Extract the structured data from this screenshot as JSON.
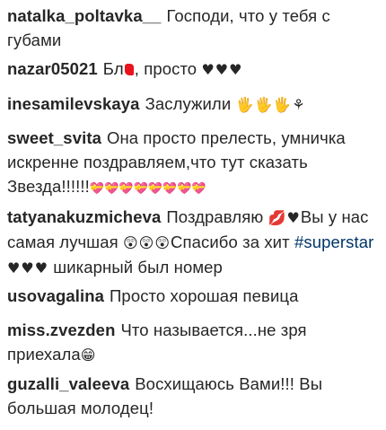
{
  "comments": [
    {
      "user": "natalka_poltavka__",
      "text": "Господи, что у тебя с губами"
    },
    {
      "user": "nazar05021",
      "text_before": "Бл",
      "text_after": ", просто",
      "emoji": "♥♥♥"
    },
    {
      "user": "inesamilevskaya",
      "text": "Заслужили",
      "emoji": "🖐🖐🖐⚘"
    },
    {
      "user": "sweet_svita",
      "text": "Она просто прелесть, умничка искренне поздравляем,что тут сказать Звезда!!!!!!",
      "emoji": "💝💝💝💝💝💝💝💝"
    },
    {
      "user": "tatyanakuzmicheva",
      "text_1": "Поздравляю",
      "emoji_1": "💋♥",
      "text_2": "Вы у нас самая лучшая",
      "emoji_2": "😲😲😲",
      "text_3": "Спасибо за хит",
      "hashtag": "#superstar",
      "emoji_3": "♥♥♥",
      "text_4": "шикарный был номер"
    },
    {
      "user": "usovagalina",
      "text": "Просто хорошая певица"
    },
    {
      "user": "miss.zvezden",
      "text": "Что называется...не зря приехала",
      "emoji": "😁"
    },
    {
      "user": "guzalli_valeeva",
      "text": "Восхищаюсь Вами!!! Вы большая молодец!"
    }
  ]
}
